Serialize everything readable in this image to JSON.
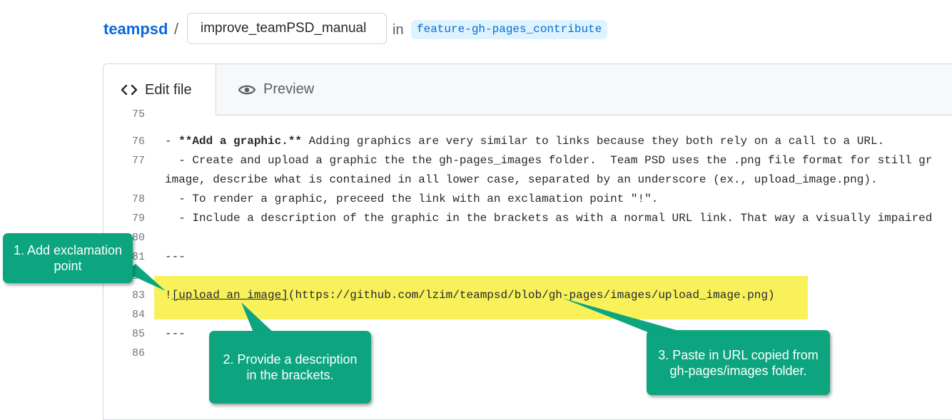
{
  "header": {
    "repo": "teampsd",
    "separator": "/",
    "filename_value": "improve_teamPSD_manual",
    "in_label": "in",
    "branch": "feature-gh-pages_contribute"
  },
  "tabs": {
    "edit_label": "Edit file",
    "preview_label": "Preview"
  },
  "code": {
    "partial_line_number": "75",
    "lines": [
      {
        "n": "76",
        "prefix": "- ",
        "bold": "**Add a graphic.**",
        "rest": " Adding graphics are very similar to links because they both rely on a call to a URL."
      },
      {
        "n": "77",
        "text": "  - Create and upload a graphic the the gh-pages_images folder.  Team PSD uses the .png file format for still gr",
        "wrap": "image, describe what is contained in all lower case, separated by an underscore (ex., upload_image.png)."
      },
      {
        "n": "78",
        "text": "  - To render a graphic, preceed the link with an exclamation point \"!\"."
      },
      {
        "n": "79",
        "text": "  - Include a description of the graphic in the brackets as with a normal URL link. That way a visually impaired"
      },
      {
        "n": "80",
        "text": ""
      },
      {
        "n": "81",
        "text": "---"
      },
      {
        "n": "82",
        "text": ""
      },
      {
        "n": "83",
        "bang": "!",
        "link_text": "[upload an image]",
        "url": "(https://github.com/lzim/teampsd/blob/gh-pages/images/upload_image.png)"
      },
      {
        "n": "84",
        "text": ""
      },
      {
        "n": "85",
        "text": "---"
      },
      {
        "n": "86",
        "text": ""
      }
    ]
  },
  "callouts": {
    "c1": "1. Add exclamation point",
    "c2": "2. Provide a description in the brackets.",
    "c3": "3. Paste in URL copied from gh-pages/images folder."
  },
  "colors": {
    "link": "#0969da",
    "branch_bg": "#ddf4ff",
    "highlight": "#f8f15a",
    "callout": "#0ca57f"
  }
}
